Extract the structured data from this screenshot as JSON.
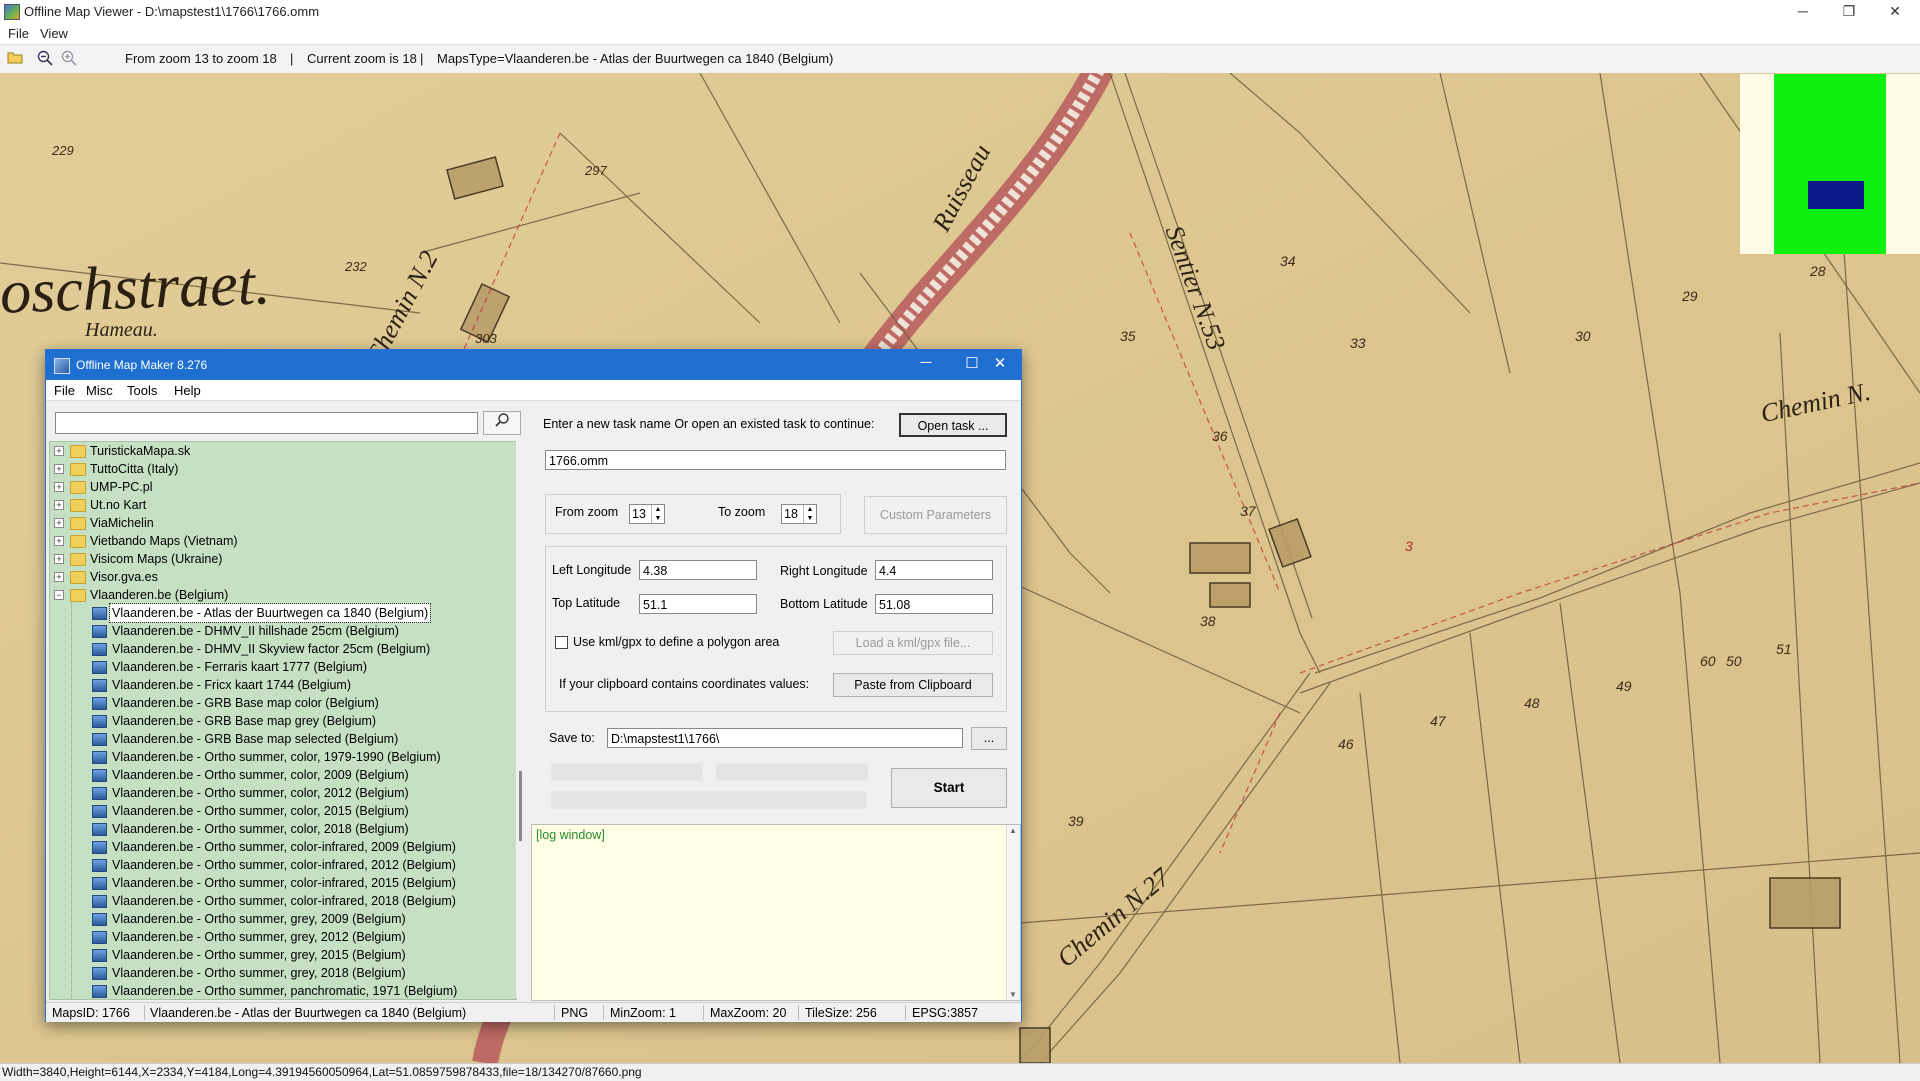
{
  "window": {
    "title": "Offline Map Viewer - D:\\mapstest1\\1766\\1766.omm",
    "controls": {
      "minimize": "─",
      "restore": "❐",
      "close": "✕"
    }
  },
  "menu": [
    "File",
    "View"
  ],
  "toolbar": {
    "open_icon": "folder-open-icon",
    "zoom_out_icon": "zoom-out-icon",
    "zoom_in_icon": "zoom-in-icon",
    "zoom_range": "From zoom 13 to zoom 18",
    "sep1": "|",
    "current_zoom": "Current zoom is 18",
    "sep2": "|",
    "maps_type": "MapsType=Vlaanderen.be - Atlas der Buurtwegen ca 1840 (Belgium)"
  },
  "map_labels": {
    "street": "oschstraet.",
    "hamlet": "Hameau.",
    "chemin1": "Chemin N.2",
    "chemin2": "Chemin N.27",
    "chemin3": "Chemin N.",
    "ruisseau": "Ruisseau",
    "sentier": "Sentier N.53",
    "parcels": [
      "229",
      "297",
      "232",
      "303",
      "35",
      "34",
      "36",
      "30",
      "33",
      "29",
      "28",
      "37",
      "38",
      "47",
      "48",
      "49",
      "50",
      "51",
      "60",
      "46",
      "39",
      "3"
    ]
  },
  "statusbar": {
    "text": "Width=3840,Height=6144,X=2334,Y=4184,Long=4.39194560050964,Lat=51.0859759878433,file=18/134270/87660.png"
  },
  "colors": {
    "dialog_title": "#1f6fd0",
    "tree_bg": "#c6e0c4",
    "overview_green": "#10f010",
    "overview_blue": "#0b1a8a",
    "map_paper": "#dcc794"
  },
  "dialog": {
    "title": "Offline Map Maker 8.276",
    "controls": {
      "minimize": "─",
      "maximize": "☐",
      "close": "✕"
    },
    "menu": [
      "File",
      "Misc",
      "Tools",
      "Help"
    ],
    "search": {
      "value": "",
      "icon": "search-icon"
    },
    "tree": {
      "folders": [
        "TuristickaMapa.sk",
        "TuttoCitta (Italy)",
        "UMP-PC.pl",
        "Ut.no Kart",
        "ViaMichelin",
        "Vietbando Maps (Vietnam)",
        "Visicom Maps (Ukraine)",
        "Visor.gva.es",
        "Vlaanderen.be (Belgium)"
      ],
      "expand_plus": "+",
      "expand_minus": "−",
      "items": [
        "Vlaanderen.be - Atlas der Buurtwegen ca 1840 (Belgium)",
        "Vlaanderen.be - DHMV_II hillshade 25cm (Belgium)",
        "Vlaanderen.be - DHMV_II Skyview factor 25cm (Belgium)",
        "Vlaanderen.be - Ferraris kaart 1777 (Belgium)",
        "Vlaanderen.be - Fricx kaart 1744 (Belgium)",
        "Vlaanderen.be - GRB Base map color (Belgium)",
        "Vlaanderen.be - GRB Base map grey (Belgium)",
        "Vlaanderen.be - GRB Base map selected (Belgium)",
        "Vlaanderen.be - Ortho summer, color, 1979-1990 (Belgium)",
        "Vlaanderen.be - Ortho summer, color, 2009 (Belgium)",
        "Vlaanderen.be - Ortho summer, color, 2012 (Belgium)",
        "Vlaanderen.be - Ortho summer, color, 2015 (Belgium)",
        "Vlaanderen.be - Ortho summer, color, 2018 (Belgium)",
        "Vlaanderen.be - Ortho summer, color-infrared, 2009 (Belgium)",
        "Vlaanderen.be - Ortho summer, color-infrared, 2012 (Belgium)",
        "Vlaanderen.be - Ortho summer, color-infrared, 2015 (Belgium)",
        "Vlaanderen.be - Ortho summer, color-infrared, 2018 (Belgium)",
        "Vlaanderen.be - Ortho summer, grey, 2009 (Belgium)",
        "Vlaanderen.be - Ortho summer, grey, 2012 (Belgium)",
        "Vlaanderen.be - Ortho summer, grey, 2015 (Belgium)",
        "Vlaanderen.be - Ortho summer, grey, 2018 (Belgium)",
        "Vlaanderen.be - Ortho summer, panchromatic, 1971 (Belgium)"
      ]
    },
    "task": {
      "prompt": "Enter a new task name Or open an existed task to continue:",
      "open_button": "Open task ...",
      "name": "1766.omm"
    },
    "zoom": {
      "from_label": "From zoom",
      "from_value": "13",
      "to_label": "To zoom",
      "to_value": "18",
      "up": "▲",
      "down": "▼",
      "custom_button": "Custom Parameters"
    },
    "coords": {
      "left_lon_label": "Left Longitude",
      "left_lon": "4.38",
      "right_lon_label": "Right Longitude",
      "right_lon": "4.4",
      "top_lat_label": "Top Latitude",
      "top_lat": "51.1",
      "bottom_lat_label": "Bottom Latitude",
      "bottom_lat": "51.08",
      "kml_label": "Use kml/gpx to define a polygon area",
      "kml_button": "Load a kml/gpx file...",
      "clipboard_label": "If your clipboard contains coordinates values:",
      "clipboard_button": "Paste from Clipboard"
    },
    "save": {
      "label": "Save to:",
      "path": "D:\\mapstest1\\1766\\",
      "browse": "...",
      "start": "Start"
    },
    "log": {
      "text": "[log window]",
      "scroll_up": "▲",
      "scroll_down": "▼"
    },
    "status": {
      "maps_id": "MapsID: 1766",
      "name": "Vlaanderen.be - Atlas der Buurtwegen ca 1840 (Belgium)",
      "format": "PNG",
      "min_zoom": "MinZoom: 1",
      "max_zoom": "MaxZoom: 20",
      "tile_size": "TileSize: 256",
      "epsg": "EPSG:3857"
    }
  }
}
